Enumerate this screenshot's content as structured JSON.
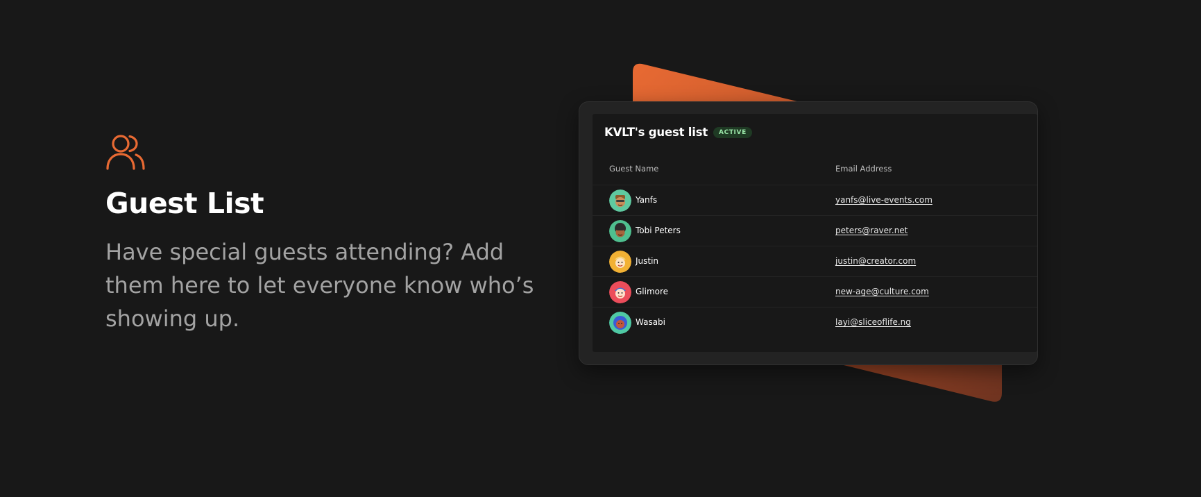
{
  "feature": {
    "icon": "users-icon",
    "title": "Guest List",
    "description": "Have special guests attending? Add them here to let everyone know who’s showing up."
  },
  "card": {
    "title": "KVLT's guest list",
    "status": "ACTIVE",
    "columns": {
      "name": "Guest Name",
      "email": "Email Address"
    },
    "guests": [
      {
        "name": "Yanfs",
        "email": "yanfs@live-events.com",
        "avatar_bg": "#5fc9a0"
      },
      {
        "name": "Tobi Peters",
        "email": "peters@raver.net",
        "avatar_bg": "#4fbf8f"
      },
      {
        "name": "Justin",
        "email": "justin@creator.com",
        "avatar_bg": "#f2b134"
      },
      {
        "name": "Glimore",
        "email": "new-age@culture.com",
        "avatar_bg": "#ec4d5b"
      },
      {
        "name": "Wasabi",
        "email": "layi@sliceoflife.ng",
        "avatar_bg": "#4fc9a4"
      }
    ]
  },
  "colors": {
    "background": "#181818",
    "accent": "#e86a33",
    "badge_bg": "#1f3a24",
    "badge_text": "#9ae6a8"
  }
}
